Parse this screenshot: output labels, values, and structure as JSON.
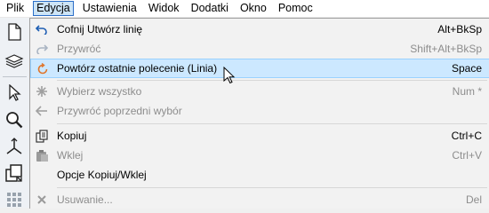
{
  "menubar": {
    "items": [
      "Plik",
      "Edycja",
      "Ustawienia",
      "Widok",
      "Dodatki",
      "Okno",
      "Pomoc"
    ],
    "active_index": 1
  },
  "toolbar": {
    "icons": [
      "new-document-icon",
      "layers-icon",
      "select-arrow-icon",
      "zoom-icon",
      "axes-icon",
      "copy-blocks-icon",
      "grid-icon"
    ]
  },
  "edit_menu": {
    "items": [
      {
        "label": "Cofnij Utwórz linię",
        "shortcut": "Alt+BkSp",
        "icon": "undo-icon",
        "enabled": true
      },
      {
        "label": "Przywróć",
        "shortcut": "Shift+Alt+BkSp",
        "icon": "redo-icon",
        "enabled": false
      },
      {
        "label": "Powtórz ostatnie polecenie (Linia)",
        "shortcut": "Space",
        "icon": "repeat-icon",
        "enabled": true,
        "highlighted": true
      },
      {
        "label": "Wybierz wszystko",
        "shortcut": "Num *",
        "icon": "select-all-icon",
        "enabled": false
      },
      {
        "label": "Przywróć poprzedni wybór",
        "shortcut": "",
        "icon": "previous-selection-icon",
        "enabled": false
      },
      {
        "label": "Kopiuj",
        "shortcut": "Ctrl+C",
        "icon": "copy-icon",
        "enabled": true
      },
      {
        "label": "Wklej",
        "shortcut": "Ctrl+V",
        "icon": "paste-icon",
        "enabled": false
      },
      {
        "label": "Opcje Kopiuj/Wklej",
        "shortcut": "",
        "icon": "",
        "enabled": true
      },
      {
        "label": "Usuwanie...",
        "shortcut": "Del",
        "icon": "delete-icon",
        "enabled": false
      }
    ]
  }
}
